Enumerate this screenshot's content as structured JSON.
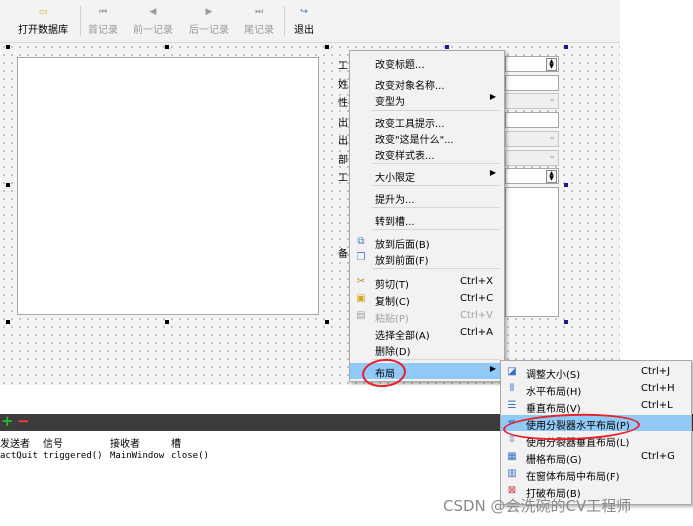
{
  "toolbar": {
    "buttons": [
      {
        "label": "打开数据库",
        "icon": "folder-icon",
        "enabled": true
      },
      {
        "label": "首记录",
        "icon": "first-record-icon",
        "enabled": false
      },
      {
        "label": "前一记录",
        "icon": "prev-record-icon",
        "enabled": false
      },
      {
        "label": "后一记录",
        "icon": "next-record-icon",
        "enabled": false
      },
      {
        "label": "尾记录",
        "icon": "last-record-icon",
        "enabled": false
      },
      {
        "label": "退出",
        "icon": "exit-icon",
        "enabled": true
      }
    ]
  },
  "form": {
    "labels": [
      "工",
      "姓",
      "性",
      "出",
      "出",
      "部",
      "工",
      "备"
    ]
  },
  "context_menu": {
    "items": [
      {
        "label": "改变标题..."
      },
      {
        "label": "改变对象名称..."
      },
      {
        "label": "变型为",
        "submenu": true
      },
      {
        "label": "改变工具提示..."
      },
      {
        "label": "改变\"这是什么\"..."
      },
      {
        "label": "改变样式表..."
      },
      {
        "label": "大小限定",
        "submenu": true
      },
      {
        "label": "提升为..."
      },
      {
        "label": "转到槽..."
      },
      {
        "label": "放到后面(B)",
        "icon": "send-back-icon"
      },
      {
        "label": "放到前面(F)",
        "icon": "bring-front-icon"
      },
      {
        "label": "剪切(T)",
        "shortcut": "Ctrl+X",
        "icon": "cut-icon"
      },
      {
        "label": "复制(C)",
        "shortcut": "Ctrl+C",
        "icon": "copy-icon"
      },
      {
        "label": "粘贴(P)",
        "shortcut": "Ctrl+V",
        "icon": "paste-icon",
        "disabled": true
      },
      {
        "label": "选择全部(A)",
        "shortcut": "Ctrl+A"
      },
      {
        "label": "删除(D)"
      },
      {
        "label": "布局",
        "submenu": true,
        "highlighted": true
      }
    ]
  },
  "layout_submenu": {
    "items": [
      {
        "label": "调整大小(S)",
        "shortcut": "Ctrl+J",
        "icon": "adjust-size-icon"
      },
      {
        "label": "水平布局(H)",
        "shortcut": "Ctrl+H",
        "icon": "horizontal-layout-icon"
      },
      {
        "label": "垂直布局(V)",
        "shortcut": "Ctrl+L",
        "icon": "vertical-layout-icon"
      },
      {
        "label": "使用分裂器水平布局(P)",
        "icon": "h-splitter-icon",
        "highlighted": true
      },
      {
        "label": "使用分裂器垂直布局(L)",
        "icon": "v-splitter-icon"
      },
      {
        "label": "栅格布局(G)",
        "shortcut": "Ctrl+G",
        "icon": "grid-layout-icon"
      },
      {
        "label": "在窗体布局中布局(F)",
        "icon": "form-layout-icon"
      },
      {
        "label": "打破布局(B)",
        "icon": "break-layout-icon"
      }
    ]
  },
  "signal_editor": {
    "add_label": "+",
    "remove_label": "−",
    "headers": [
      "发送者",
      "信号",
      "接收者",
      "槽"
    ],
    "rows": [
      [
        "actQuit",
        "triggered()",
        "MainWindow",
        "close()"
      ]
    ]
  },
  "watermark": "CSDN @会洗碗的CV工程师",
  "colors": {
    "highlight": "#91c9f7",
    "annotation": "#e8202a",
    "add": "#2dbb2d",
    "remove": "#ff3a3a"
  }
}
